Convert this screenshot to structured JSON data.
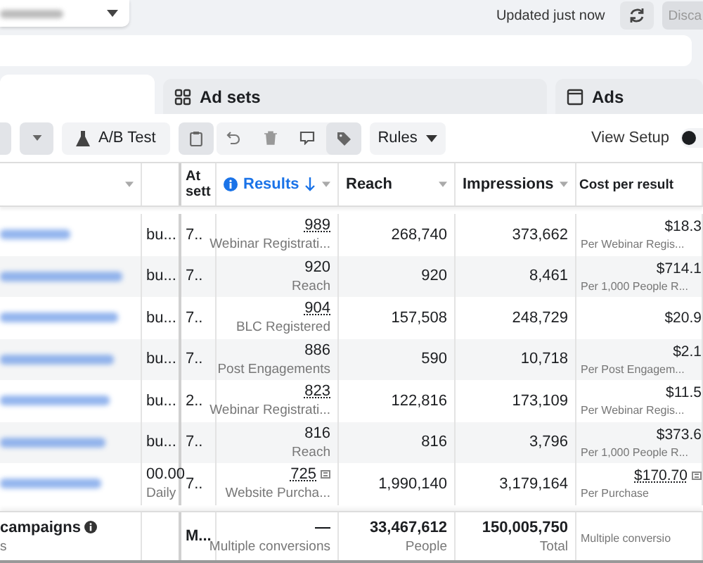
{
  "top_bar": {
    "status": "Updated just now",
    "discard_button": "Disca"
  },
  "tabs": [
    {
      "kind": "blank",
      "selected": true
    },
    {
      "label": "Ad sets",
      "kind": "grid",
      "selected": false
    },
    {
      "label": "Ads",
      "kind": "window",
      "selected": false
    }
  ],
  "toolbar": {
    "ab_test": "A/B Test",
    "rules": "Rules",
    "view_setup": {
      "label": "View Setup",
      "on": false
    }
  },
  "table": {
    "columns": [
      {
        "sorted": false
      },
      {
        "sorted": false
      },
      {
        "label": "At sett",
        "sorted": false
      },
      {
        "label": "Results",
        "sorted": true
      },
      {
        "label": "Reach",
        "sorted": false
      },
      {
        "label": "Impressions",
        "sorted": false
      },
      {
        "label": "Cost per result",
        "sorted": false
      }
    ],
    "rows": [
      {
        "budget": "bu...",
        "budget_sub": "",
        "col3": "7..",
        "results": "989",
        "results_sub": "Webinar Registrati...",
        "results_underlined": true,
        "flag": false,
        "reach": "268,740",
        "impressions": "373,662",
        "cost": "$18.3",
        "cost_sub": "Per Webinar Regis...",
        "cost_underlined": false
      },
      {
        "budget": "bu...",
        "budget_sub": "",
        "col3": "7..",
        "results": "920",
        "results_sub": "Reach",
        "results_underlined": false,
        "flag": false,
        "reach": "920",
        "impressions": "8,461",
        "cost": "$714.1",
        "cost_sub": "Per 1,000 People R...",
        "cost_underlined": false
      },
      {
        "budget": "bu...",
        "budget_sub": "",
        "col3": "7..",
        "results": "904",
        "results_sub": "BLC Registered",
        "results_underlined": true,
        "flag": false,
        "reach": "157,508",
        "impressions": "248,729",
        "cost": "$20.9",
        "cost_sub": "",
        "cost_underlined": false
      },
      {
        "budget": "bu...",
        "budget_sub": "",
        "col3": "7..",
        "results": "886",
        "results_sub": "Post Engagements",
        "results_underlined": false,
        "flag": false,
        "reach": "590",
        "impressions": "10,718",
        "cost": "$2.1",
        "cost_sub": "Per Post Engagem...",
        "cost_underlined": false
      },
      {
        "budget": "bu...",
        "budget_sub": "",
        "col3": "2..",
        "results": "823",
        "results_sub": "Webinar Registrati...",
        "results_underlined": true,
        "flag": false,
        "reach": "122,816",
        "impressions": "173,109",
        "cost": "$11.5",
        "cost_sub": "Per Webinar Regis...",
        "cost_underlined": false
      },
      {
        "budget": "bu...",
        "budget_sub": "",
        "col3": "7..",
        "results": "816",
        "results_sub": "Reach",
        "results_underlined": false,
        "flag": false,
        "reach": "816",
        "impressions": "3,796",
        "cost": "$373.6",
        "cost_sub": "Per 1,000 People R...",
        "cost_underlined": false
      },
      {
        "budget": "00.00",
        "budget_sub": "Daily",
        "col3": "7..",
        "results": "725",
        "results_sub": "Website Purcha...",
        "results_underlined": true,
        "flag": true,
        "reach": "1,990,140",
        "impressions": "3,179,164",
        "cost": "$170.70",
        "cost_sub": "Per Purchase",
        "cost_underlined": true
      }
    ],
    "footer": {
      "name": "campaigns",
      "name_sub": "s",
      "col3": "M...",
      "results": "—",
      "results_sub": "Multiple conversions",
      "reach": "33,467,612",
      "reach_sub": "People",
      "impressions": "150,005,750",
      "impressions_sub": "Total",
      "cost_sub": "Multiple conversio"
    }
  }
}
